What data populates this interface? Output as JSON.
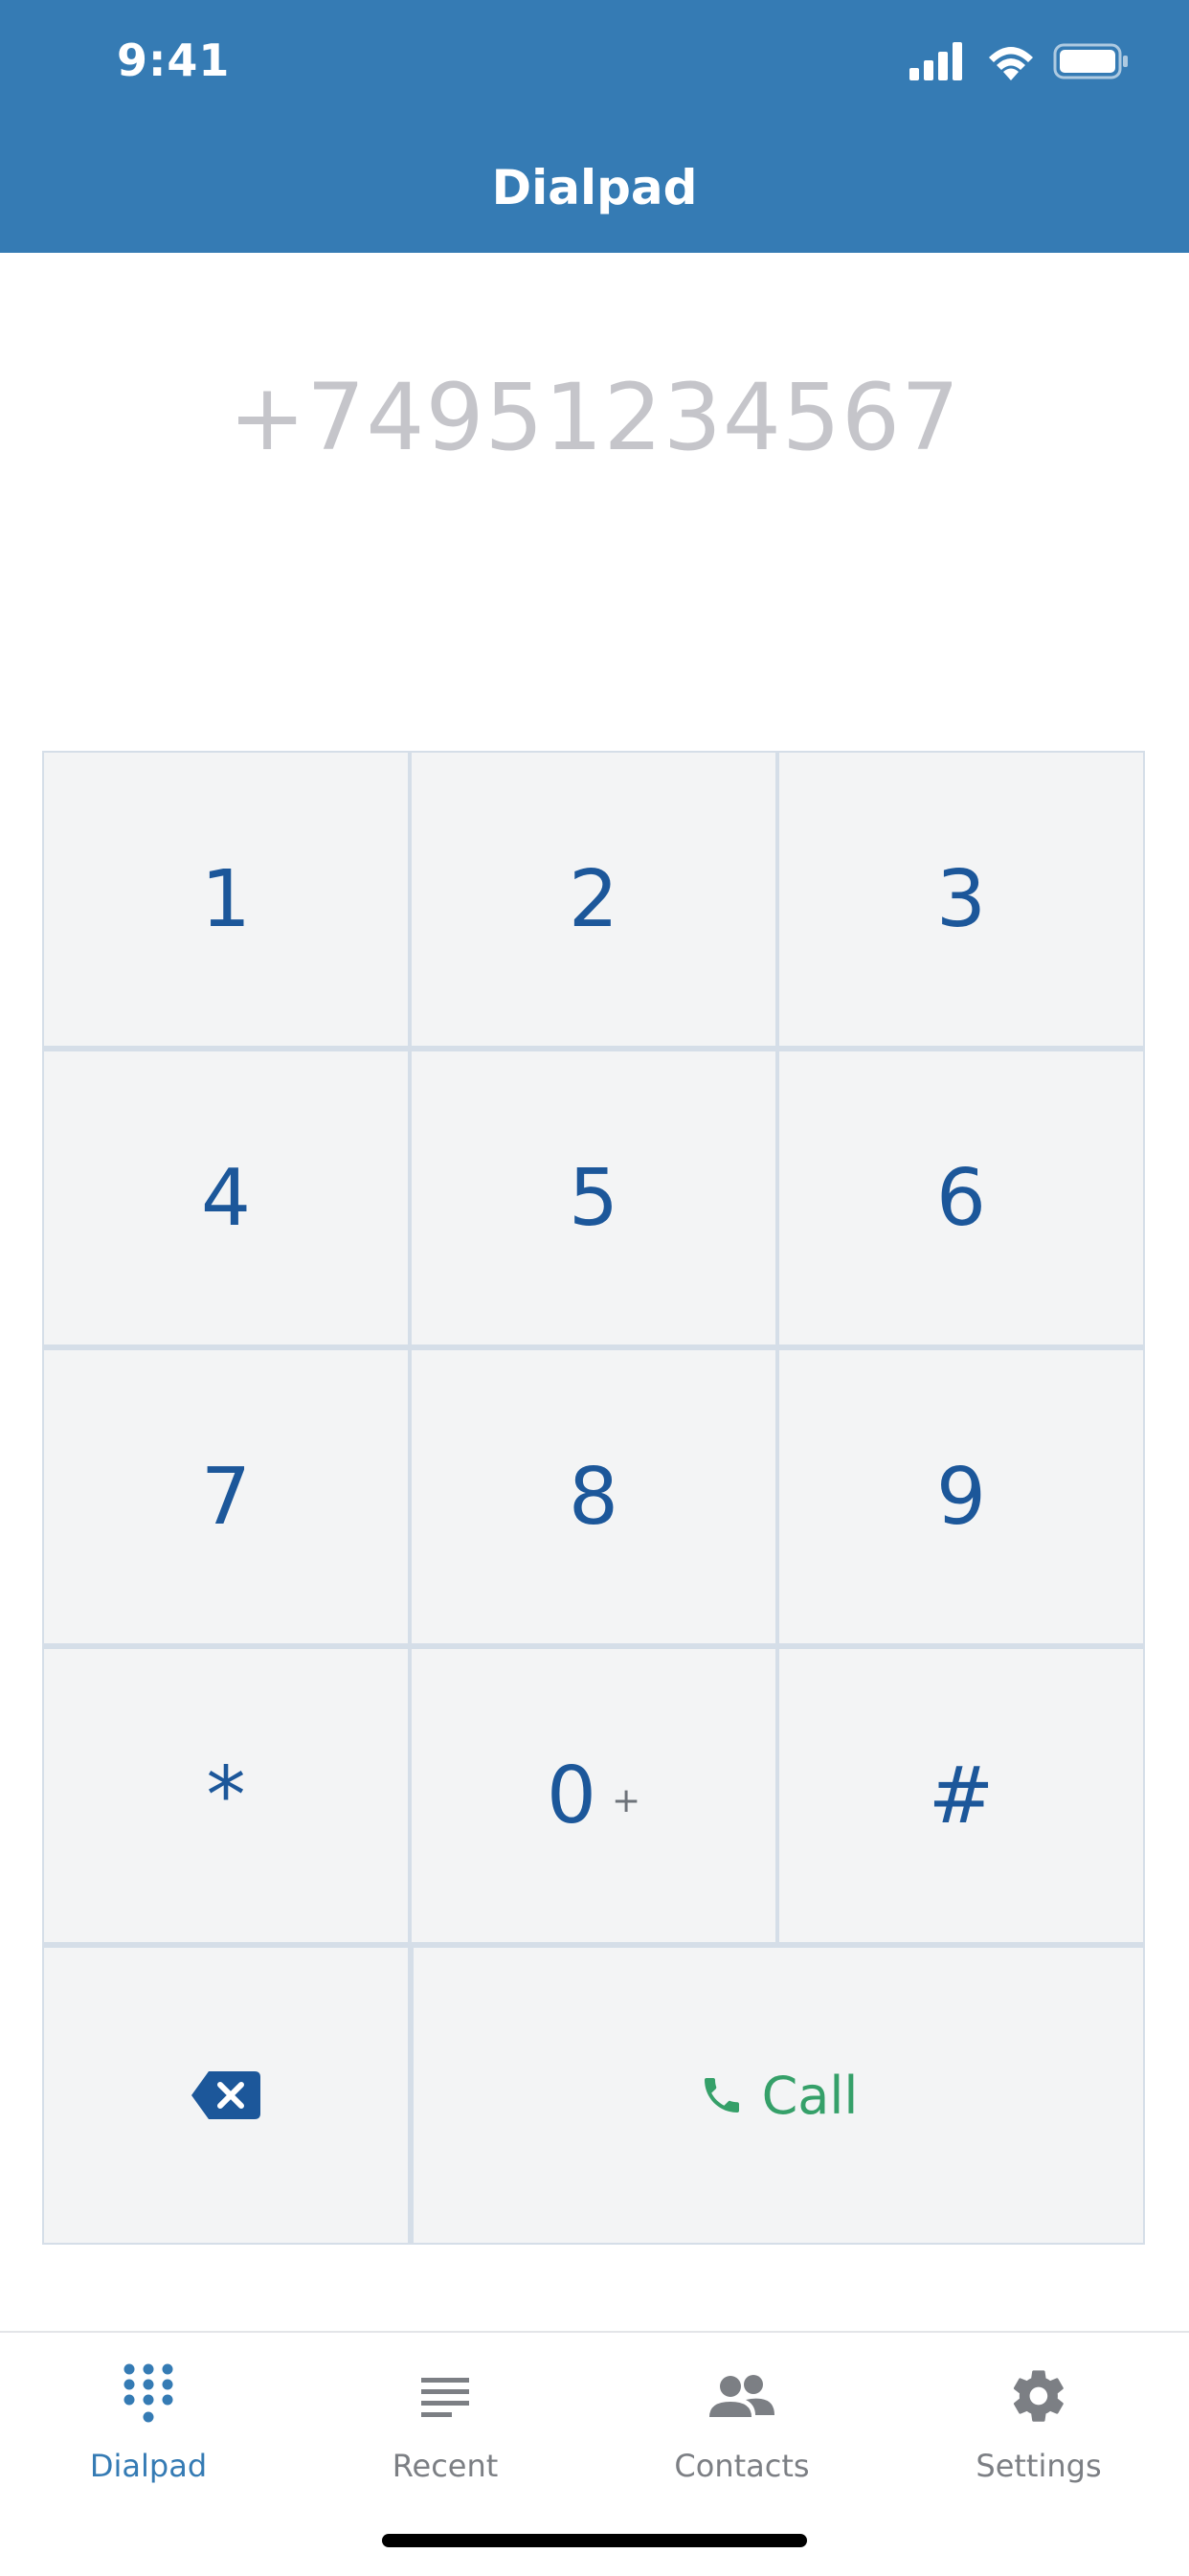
{
  "status_bar": {
    "time": "9:41",
    "icons": [
      "signal-icon",
      "wifi-icon",
      "battery-icon"
    ]
  },
  "header": {
    "title": "Dialpad",
    "background_color": "#357BB4"
  },
  "display": {
    "number": "+74951234567"
  },
  "keypad": {
    "keys": [
      {
        "label": "1",
        "sub": ""
      },
      {
        "label": "2",
        "sub": ""
      },
      {
        "label": "3",
        "sub": ""
      },
      {
        "label": "4",
        "sub": ""
      },
      {
        "label": "5",
        "sub": ""
      },
      {
        "label": "6",
        "sub": ""
      },
      {
        "label": "7",
        "sub": ""
      },
      {
        "label": "8",
        "sub": ""
      },
      {
        "label": "9",
        "sub": ""
      },
      {
        "label": "*",
        "sub": ""
      },
      {
        "label": "0",
        "sub": "+"
      },
      {
        "label": "#",
        "sub": ""
      }
    ],
    "backspace_icon": "backspace-icon",
    "call_label": "Call",
    "call_icon": "phone-icon",
    "digit_color": "#1C579A",
    "call_color": "#35A069"
  },
  "tabbar": {
    "tabs": [
      {
        "label": "Dialpad",
        "icon": "dialpad-icon",
        "active": true
      },
      {
        "label": "Recent",
        "icon": "list-icon",
        "active": false
      },
      {
        "label": "Contacts",
        "icon": "people-icon",
        "active": false
      },
      {
        "label": "Settings",
        "icon": "gear-icon",
        "active": false
      }
    ],
    "active_color": "#357BB4",
    "inactive_color": "#7C7F84"
  }
}
